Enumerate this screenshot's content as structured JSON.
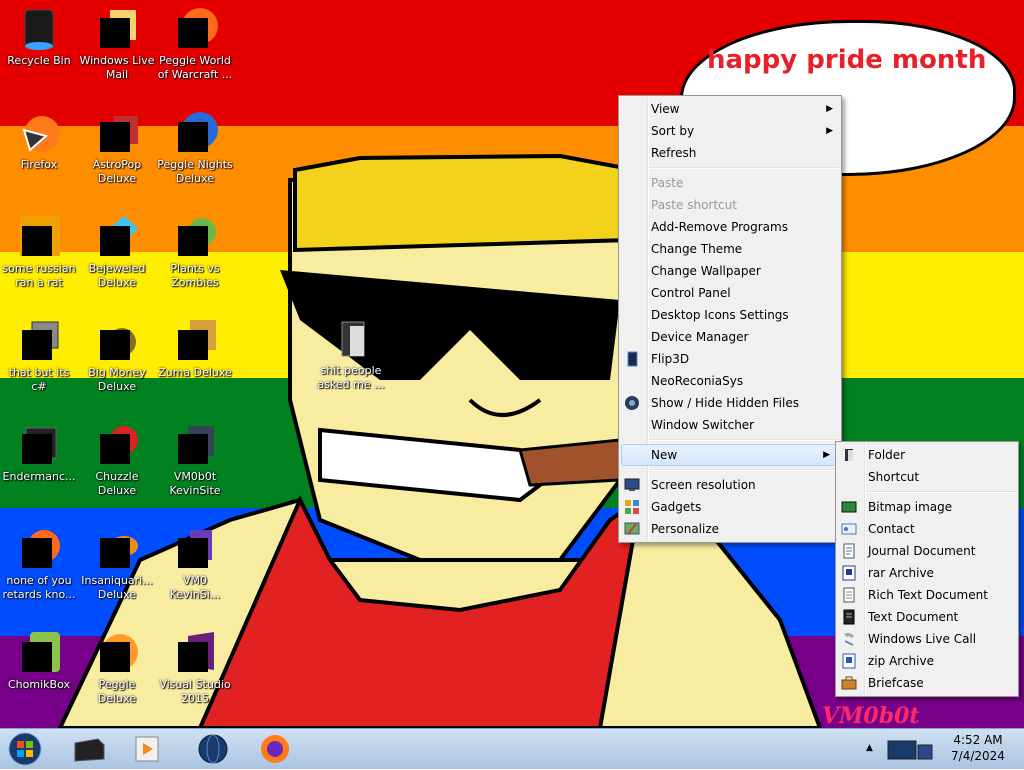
{
  "desktop": {
    "bands": [
      "#e50000",
      "#ff8d00",
      "#ffee00",
      "#028121",
      "#004cff",
      "#770088"
    ],
    "icons": [
      {
        "label": "Recycle Bin"
      },
      {
        "label": "Windows Live\nMail"
      },
      {
        "label": "Peggle World\nof Warcraft ..."
      },
      {
        "label": "Firefox"
      },
      {
        "label": "AstroPop\nDeluxe"
      },
      {
        "label": "Peggle Nights\nDeluxe"
      },
      {
        "label": "some russian\nran a rat"
      },
      {
        "label": "Bejeweled\nDeluxe"
      },
      {
        "label": "Plants vs\nZombies"
      },
      {
        "label": "that but its c#"
      },
      {
        "label": "Big Money\nDeluxe"
      },
      {
        "label": "Zuma Deluxe"
      },
      {
        "label": "Endermanc..."
      },
      {
        "label": "Chuzzle\nDeluxe"
      },
      {
        "label": "VM0b0t\nKevinSite"
      },
      {
        "label": "none of you\nretards kno..."
      },
      {
        "label": "Insaniquari...\nDeluxe"
      },
      {
        "label": "VM0\nKevinSi..."
      },
      {
        "label": "ChomikBox"
      },
      {
        "label": "Peggle Deluxe"
      },
      {
        "label": "Visual Studio\n2015"
      },
      {
        "label": "shit people\nasked me ..."
      }
    ],
    "bubble_text": "happy pride month",
    "watermark": "VM0b0t"
  },
  "context_menu": {
    "items": [
      {
        "label": "View"
      },
      {
        "label": "Sort by"
      },
      {
        "label": "Refresh"
      },
      {
        "label": "Paste"
      },
      {
        "label": "Paste shortcut"
      },
      {
        "label": "Add-Remove Programs"
      },
      {
        "label": "Change Theme"
      },
      {
        "label": "Change Wallpaper"
      },
      {
        "label": "Control Panel"
      },
      {
        "label": "Desktop Icons Settings"
      },
      {
        "label": "Device Manager"
      },
      {
        "label": "Flip3D"
      },
      {
        "label": "NeoReconiaSys"
      },
      {
        "label": "Show / Hide Hidden Files"
      },
      {
        "label": "Window Switcher"
      },
      {
        "label": "New"
      },
      {
        "label": "Screen resolution"
      },
      {
        "label": "Gadgets"
      },
      {
        "label": "Personalize"
      }
    ]
  },
  "new_submenu": {
    "items": [
      {
        "label": "Folder"
      },
      {
        "label": "Shortcut"
      },
      {
        "label": "Bitmap image"
      },
      {
        "label": "Contact"
      },
      {
        "label": "Journal Document"
      },
      {
        "label": "rar Archive"
      },
      {
        "label": "Rich Text Document"
      },
      {
        "label": "Text Document"
      },
      {
        "label": "Windows Live Call"
      },
      {
        "label": "zip Archive"
      },
      {
        "label": "Briefcase"
      }
    ]
  },
  "taskbar": {
    "time": "4:52 AM",
    "date": "7/4/2024"
  }
}
